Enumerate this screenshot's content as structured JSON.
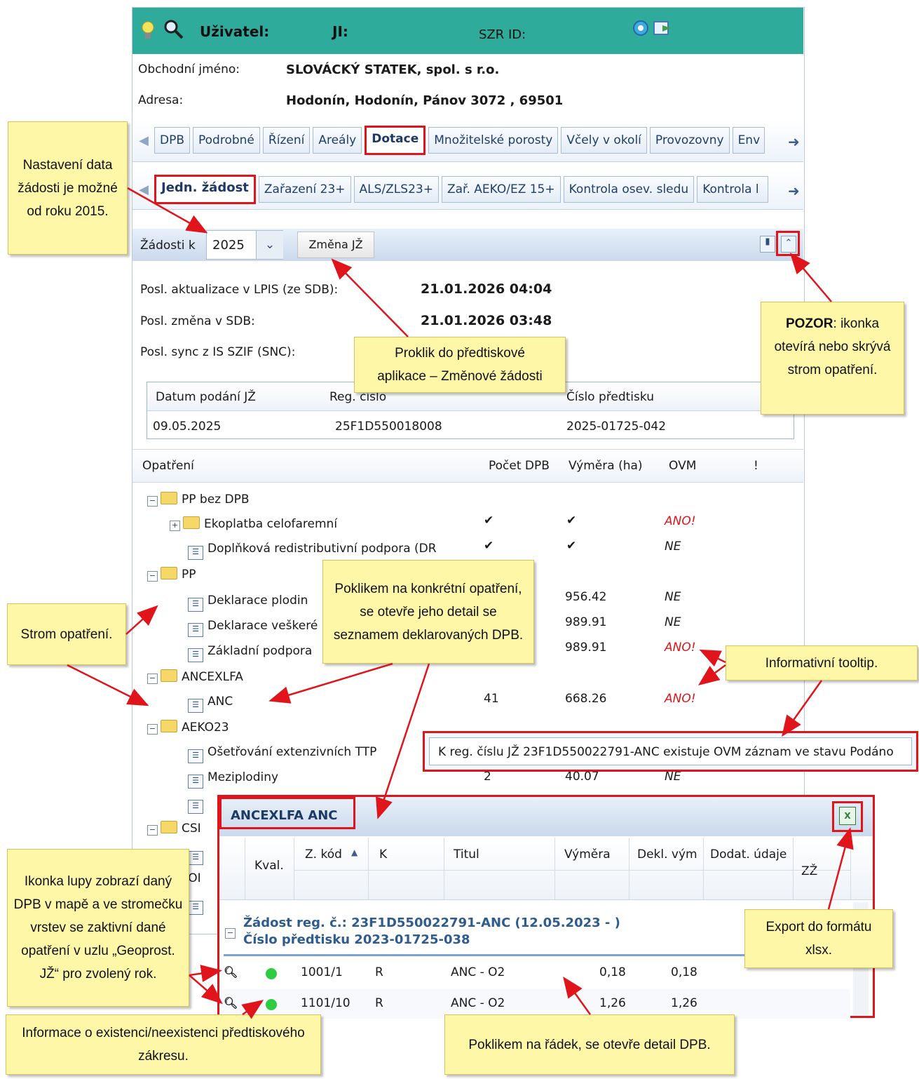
{
  "header": {
    "user_label": "Uživatel:",
    "ji_label": "JI:",
    "szr_label": "SZR ID:",
    "icons": [
      "lightbulb-icon",
      "search-icon",
      "refresh-icon",
      "export-icon"
    ]
  },
  "info": {
    "name_label": "Obchodní jméno:",
    "name_value": "SLOVÁCKÝ STATEK, spol. s r.o.",
    "address_label": "Adresa:",
    "address_value": "Hodonín, Hodonín, Pánov 3072 , 69501"
  },
  "tabs1": [
    "DPB",
    "Podrobné",
    "Řízení",
    "Areály",
    "Dotace",
    "Množitelské porosty",
    "Včely v okolí",
    "Provozovny",
    "Env"
  ],
  "tabs2": [
    "Jedn. žádost",
    "Zařazení 23+",
    "ALS/ZLS23+",
    "Zař. AEKO/EZ 15+",
    "Kontrola osev. sledu",
    "Kontrola l"
  ],
  "toolbar": {
    "zadosti_label": "Žádosti k",
    "year": "2025",
    "change_button": "Změna JŽ"
  },
  "status": {
    "lpis_label": "Posl. aktualizace v LPIS (ze SDB):",
    "lpis_value": "21.01.2026 04:04",
    "sdb_label": "Posl. změna v SDB:",
    "sdb_value": "21.01.2026 03:48",
    "sync_label": "Posl. sync z IS SZIF (SNC):"
  },
  "request_grid": {
    "headers": [
      "Datum podání JŽ",
      "Reg. číslo",
      "Číslo předtisku"
    ],
    "row": [
      "09.05.2025",
      "25F1D550018008",
      "2025-01725-042"
    ]
  },
  "tree": {
    "headers": [
      "Opatření",
      "Počet DPB",
      "Výměra (ha)",
      "OVM",
      "!"
    ],
    "rows": [
      {
        "label": "PP bez DPB",
        "count": "",
        "area": "",
        "ovm": ""
      },
      {
        "label": "Ekoplatba celofaremní",
        "count": "✔",
        "area": "✔",
        "ovm": "ANO!"
      },
      {
        "label": "Doplňková redistributivní podpora (DR",
        "count": "✔",
        "area": "✔",
        "ovm": "NE"
      },
      {
        "label": "PP",
        "count": "",
        "area": "",
        "ovm": ""
      },
      {
        "label": "Deklarace plodin",
        "count": "",
        "area": "956.42",
        "ovm": "NE"
      },
      {
        "label": "Deklarace veškeré",
        "count": "",
        "area": "989.91",
        "ovm": "NE"
      },
      {
        "label": "Základní podpora",
        "count": "",
        "area": "989.91",
        "ovm": "ANO!"
      },
      {
        "label": "ANCEXLFA",
        "count": "",
        "area": "",
        "ovm": ""
      },
      {
        "label": "ANC",
        "count": "41",
        "area": "668.26",
        "ovm": "ANO!"
      },
      {
        "label": "AEKO23",
        "count": "",
        "area": "",
        "ovm": ""
      },
      {
        "label": "Ošetřování extenzivních TTP",
        "count": "",
        "area": "",
        "ovm": ""
      },
      {
        "label": "Meziplodiny",
        "count": "2",
        "area": "40.07",
        "ovm": "NE"
      },
      {
        "label": "",
        "count": "",
        "area": "",
        "ovm": ""
      },
      {
        "label": "CSI",
        "count": "",
        "area": "",
        "ovm": ""
      },
      {
        "label": "",
        "count": "",
        "area": "",
        "ovm": ""
      },
      {
        "label": "POI",
        "count": "",
        "area": "",
        "ovm": ""
      },
      {
        "label": "",
        "count": "",
        "area": "",
        "ovm": ""
      }
    ]
  },
  "tooltip": "K reg. číslu JŽ 23F1D550022791-ANC existuje OVM záznam ve stavu Podáno",
  "detail": {
    "title": "ANCEXLFA ANC",
    "headers": [
      "Kval.",
      "Z. kód",
      "K",
      "Titul",
      "Výměra",
      "Dekl. vým",
      "Dodat. údaje",
      "ZŽ"
    ],
    "group_line1": "Žádost reg. č.: 23F1D550022791-ANC (12.05.2023 - )",
    "group_line2": "Číslo předtisku 2023-01725-038",
    "rows": [
      {
        "code": "1001/1",
        "k": "R",
        "titul": "ANC - O2",
        "vymera": "0,18",
        "dekl": "0,18"
      },
      {
        "code": "1101/10",
        "k": "R",
        "titul": "ANC - O2",
        "vymera": "1,26",
        "dekl": "1,26"
      }
    ]
  },
  "callouts": {
    "date": "Nastavení data žádosti je možné od roku 2015.",
    "proklik_line1": "Proklik do předtiskové",
    "proklik_line2": "aplikace – Změnové žádosti",
    "pozor_bold": "POZOR",
    "pozor_text": ": ikonka otevírá nebo skrývá strom opatření.",
    "tree": "Strom opatření.",
    "poklik": "Poklikem na konkrétní opatření, se otevře jeho detail se seznamem deklarovaných DPB.",
    "tooltip_info": "Informativní tooltip.",
    "export": "Export do formátu xlsx.",
    "lupa": "Ikonka lupy zobrazí daný DPB v mapě a ve stromečku vrstev se zaktivní dané opatření v uzlu „Geoprost. JŽ“ pro zvolený rok.",
    "predtisk": "Informace o existenci/neexistenci předtiskového zákresu.",
    "radek": "Poklikem na řádek, se otevře detail DPB."
  }
}
